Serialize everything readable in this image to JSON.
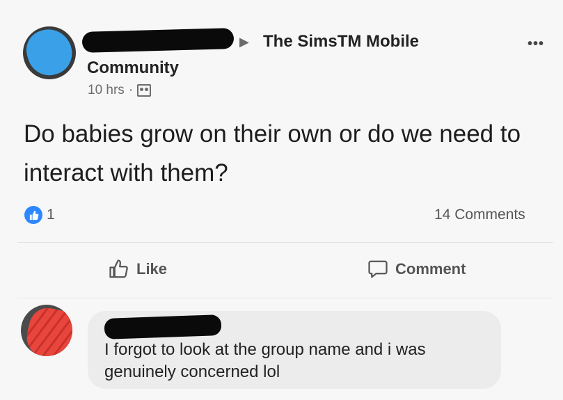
{
  "post": {
    "group_name": "The SimsTM Mobile",
    "group_suffix": "Community",
    "time": "10 hrs",
    "separator": "·",
    "text": "Do babies grow on their own or do we need to interact with them?",
    "like_count": "1",
    "comments_count": "14 Comments"
  },
  "actions": {
    "like_label": "Like",
    "comment_label": "Comment"
  },
  "comment": {
    "text": "I forgot to look at the group name and i was genuinely concerned lol"
  },
  "colors": {
    "like_blue": "#2d88ff",
    "bubble_bg": "#ececec"
  }
}
